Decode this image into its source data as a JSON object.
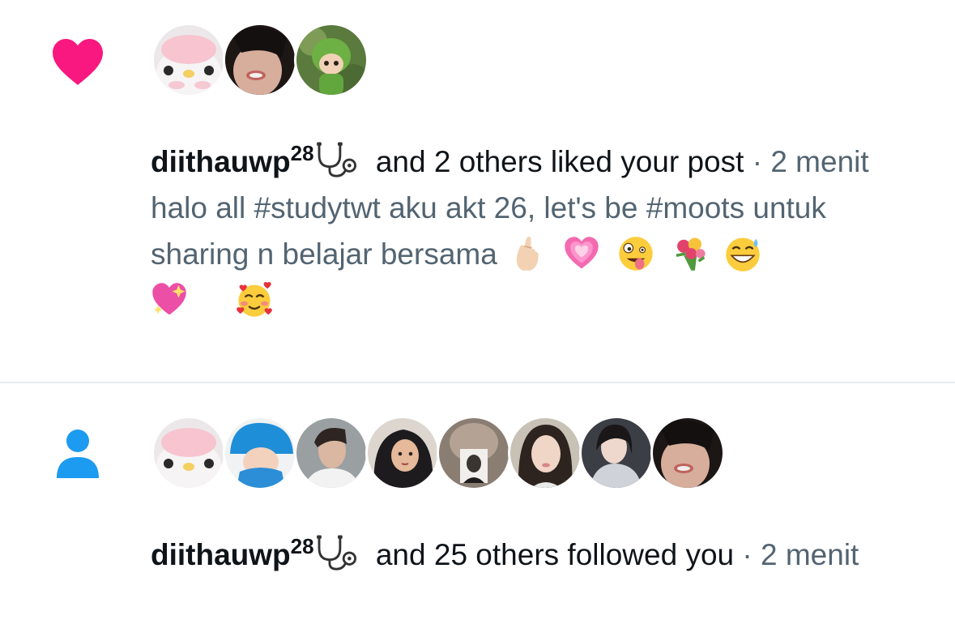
{
  "notifications": [
    {
      "type": "like",
      "icon": "heart-icon",
      "icon_color": "#f91880",
      "username": "diithauwp",
      "username_sup": "28",
      "action": "and 2 others liked your post",
      "separator": " · ",
      "time": "2 menit",
      "post_text": "halo all #studytwt aku akt 26, let's be #moots untuk sharing n belajar bersama",
      "post_emojis": [
        "crossed-fingers-emoji",
        "growing-heart-emoji",
        "zany-face-emoji",
        "bouquet-emoji",
        "grinning-sweat-emoji",
        "sparkling-heart-emoji",
        "smiling-hearts-emoji"
      ],
      "avatars": [
        "plush-toy-avatar",
        "girl-selfie-avatar",
        "dino-figure-avatar"
      ]
    },
    {
      "type": "follow",
      "icon": "person-icon",
      "icon_color": "#1d9bf0",
      "username": "diithauwp",
      "username_sup": "28",
      "action": "and 25 others followed you",
      "separator": " · ",
      "time": "2 menit",
      "avatars": [
        "plush-toy-avatar",
        "pocoyo-avatar",
        "boy-photo-avatar",
        "hijab-cartoon-avatar",
        "photo-card-avatar",
        "girl-portrait-avatar",
        "girl-mirror-avatar",
        "girl-selfie-avatar"
      ]
    }
  ],
  "colors": {
    "text_primary": "#0f1419",
    "text_secondary": "#536471",
    "divider": "#e7eaed"
  }
}
